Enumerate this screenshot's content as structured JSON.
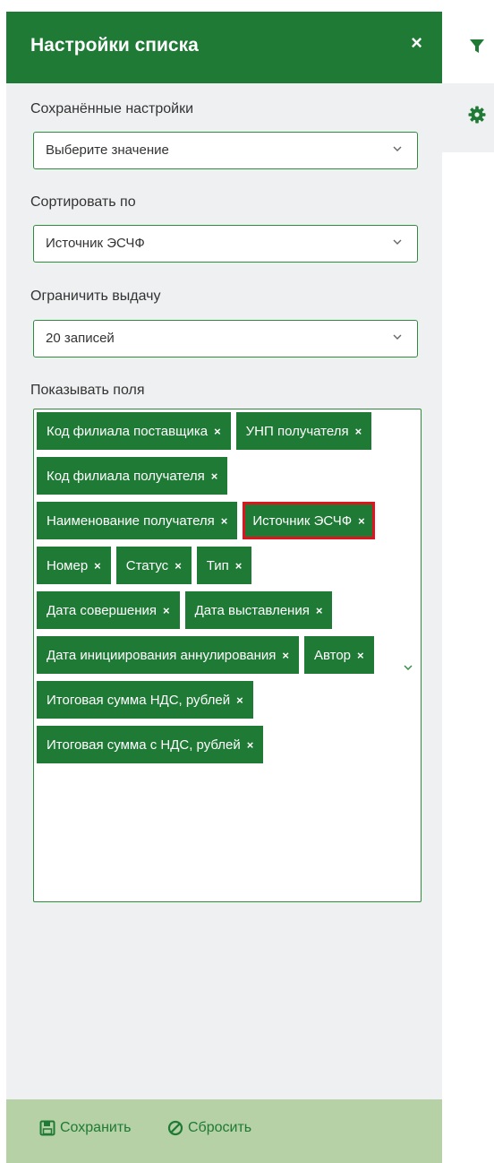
{
  "panel": {
    "title": "Настройки списка",
    "close_glyph": "×"
  },
  "saved_settings": {
    "label": "Сохранённые настройки",
    "value": "Выберите значение"
  },
  "sort_by": {
    "label": "Сортировать по",
    "value": "Источник ЭСЧФ"
  },
  "limit": {
    "label": "Ограничить выдачу",
    "value": "20 записей"
  },
  "fields": {
    "label": "Показывать поля",
    "remove_glyph": "×",
    "tags": [
      "Код филиала поставщика",
      "УНП получателя",
      "Код филиала получателя",
      "Наименование получателя",
      "Источник ЭСЧФ",
      "Номер",
      "Статус",
      "Тип",
      "Дата совершения",
      "Дата выставления",
      "Дата инициирования аннулирования",
      "Автор",
      "Итоговая сумма НДС, рублей",
      "Итоговая сумма с НДС, рублей"
    ],
    "highlighted_tag": "Источник ЭСЧФ"
  },
  "footer": {
    "save_label": "Сохранить",
    "reset_label": "Сбросить"
  },
  "icons": {
    "filter": "filter-icon",
    "settings": "gear-icon",
    "close": "close-icon",
    "save": "floppy-disk-icon",
    "reset": "ban-icon",
    "dropdown": "chevron-down-icon"
  },
  "colors": {
    "brand_green": "#1e7a35",
    "panel_bg": "#eef0f2",
    "footer_bg": "#b5d1a5",
    "highlight": "#e0141e"
  }
}
